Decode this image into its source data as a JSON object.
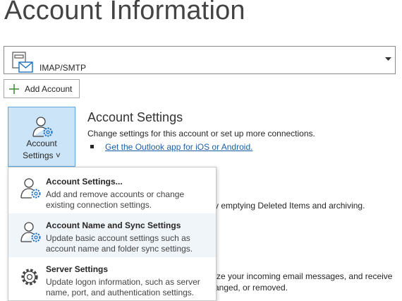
{
  "page": {
    "title": "Account Information"
  },
  "account_selector": {
    "account_name": "IMAP/SMTP"
  },
  "add_account": {
    "label": "Add Account"
  },
  "account_settings_button": {
    "line1": "Account",
    "line2": "Settings ˅"
  },
  "account_settings_section": {
    "title": "Account Settings",
    "description": "Change settings for this account or set up more connections.",
    "link": "Get the Outlook app for iOS or Android."
  },
  "background_text": {
    "mailbox_cleanup": "y emptying Deleted Items and archiving.",
    "rules_line1": "ze your incoming email messages, and receive",
    "rules_line2": "anged, or removed."
  },
  "dropdown": {
    "items": [
      {
        "title": "Account Settings...",
        "desc1": "Add and remove accounts or change",
        "desc2": "existing connection settings."
      },
      {
        "title": "Account Name and Sync Settings",
        "desc1": "Update basic account settings such as",
        "desc2": "account name and folder sync settings."
      },
      {
        "title": "Server Settings",
        "desc1": "Update logon information, such as server",
        "desc2": "name, port, and authentication settings."
      }
    ]
  },
  "colors": {
    "accent_blue": "#1a5fa8",
    "button_selected_bg": "#cce4f7",
    "button_selected_border": "#5fa6e0",
    "plus_green": "#3c8a2e",
    "menu_highlight": "#f0f5fa"
  },
  "icons": [
    "mailbox-icon",
    "chevron-down-icon",
    "plus-icon",
    "user-gear-icon",
    "gear-icon",
    "bullet-icon"
  ]
}
